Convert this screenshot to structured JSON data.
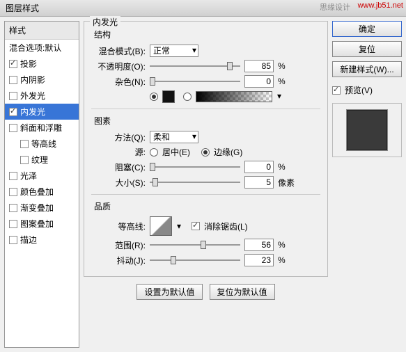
{
  "watermark": "www.jb51.net",
  "watermark2": "思缘设计",
  "title": "图层样式",
  "left": {
    "header": "样式",
    "blendDefault": "混合选项:默认",
    "items": [
      {
        "label": "投影",
        "checked": true,
        "indent": false
      },
      {
        "label": "内阴影",
        "checked": false,
        "indent": false
      },
      {
        "label": "外发光",
        "checked": false,
        "indent": false
      },
      {
        "label": "内发光",
        "checked": true,
        "indent": false,
        "selected": true
      },
      {
        "label": "斜面和浮雕",
        "checked": false,
        "indent": false
      },
      {
        "label": "等高线",
        "checked": false,
        "indent": true
      },
      {
        "label": "纹理",
        "checked": false,
        "indent": true
      },
      {
        "label": "光泽",
        "checked": false,
        "indent": false
      },
      {
        "label": "颜色叠加",
        "checked": false,
        "indent": false
      },
      {
        "label": "渐变叠加",
        "checked": false,
        "indent": false
      },
      {
        "label": "图案叠加",
        "checked": false,
        "indent": false
      },
      {
        "label": "描边",
        "checked": false,
        "indent": false
      }
    ]
  },
  "panel": {
    "title": "内发光",
    "structure": {
      "title": "结构",
      "blendModeLabel": "混合模式(B):",
      "blendModeValue": "正常",
      "opacityLabel": "不透明度(O):",
      "opacityValue": "85",
      "noiseLabel": "杂色(N):",
      "noiseValue": "0",
      "pct": "%"
    },
    "element": {
      "title": "图素",
      "methodLabel": "方法(Q):",
      "methodValue": "柔和",
      "sourceLabel": "源:",
      "sourceCenter": "居中(E)",
      "sourceEdge": "边缘(G)",
      "chokeLabel": "阻塞(C):",
      "chokeValue": "0",
      "sizeLabel": "大小(S):",
      "sizeValue": "5",
      "pct": "%",
      "px": "像素"
    },
    "quality": {
      "title": "品质",
      "contourLabel": "等高线:",
      "antiAlias": "消除锯齿(L)",
      "rangeLabel": "范围(R):",
      "rangeValue": "56",
      "jitterLabel": "抖动(J):",
      "jitterValue": "23",
      "pct": "%"
    },
    "buttons": {
      "setDefault": "设置为默认值",
      "resetDefault": "复位为默认值"
    }
  },
  "right": {
    "ok": "确定",
    "reset": "复位",
    "newStyle": "新建样式(W)...",
    "previewLabel": "预览(V)"
  }
}
